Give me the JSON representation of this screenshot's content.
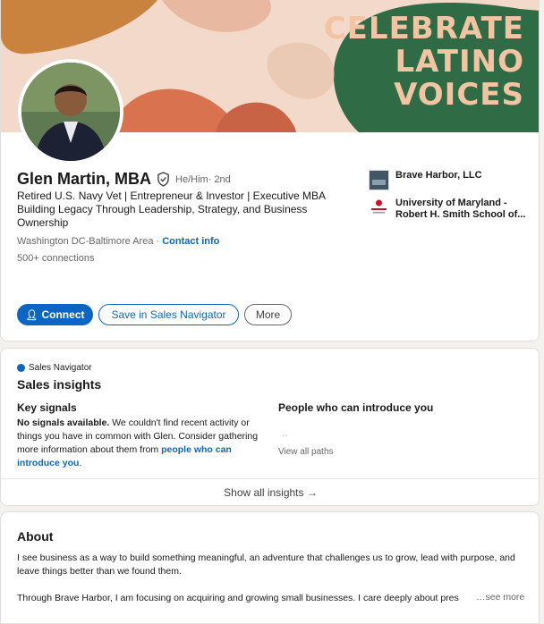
{
  "profile": {
    "banner_text_lines": [
      "CELEBRATE",
      "LATINO",
      "VOICES"
    ],
    "name": "Glen Martin, MBA",
    "pronouns": "He/Him",
    "degree": "· 2nd",
    "headline": "Retired U.S. Navy Vet | Entrepreneur & Investor | Executive MBA Building Legacy Through Leadership, Strategy, and Business Ownership",
    "location": "Washington DC-Baltimore Area",
    "location_sep": " · ",
    "contact_info": "Contact info",
    "connections": "500+ connections",
    "company": "Brave Harbor, LLC",
    "school": "University of Maryland - Robert H. Smith School of...",
    "buttons": {
      "connect": "Connect",
      "save": "Save in Sales Navigator",
      "more": "More"
    }
  },
  "insights": {
    "brand": "Sales Navigator",
    "title": "Sales insights",
    "key_signals_title": "Key signals",
    "key_signals_bold": "No signals available.",
    "key_signals_text": " We couldn't find recent activity or things you have in common with Glen. Consider gathering more information about them from ",
    "key_signals_link": "people who can introduce you",
    "key_signals_end": ".",
    "people_title": "People who can introduce you",
    "people_placeholder": "--",
    "view_paths": "View all paths",
    "show_all": "Show all insights →"
  },
  "about": {
    "title": "About",
    "p1": "I see business as a way to build something meaningful, an adventure that challenges us to grow, lead with purpose, and leave things better than we found them.",
    "p2": "Through Brave Harbor, I am focusing on acquiring and growing small businesses. I care deeply about pres",
    "see_more": "…see more"
  },
  "colors": {
    "accent": "#0a66c2",
    "banner_bg": "#f3d9c9",
    "banner_text": "#f3c4a2",
    "leaf_green": "#2f6b45"
  }
}
